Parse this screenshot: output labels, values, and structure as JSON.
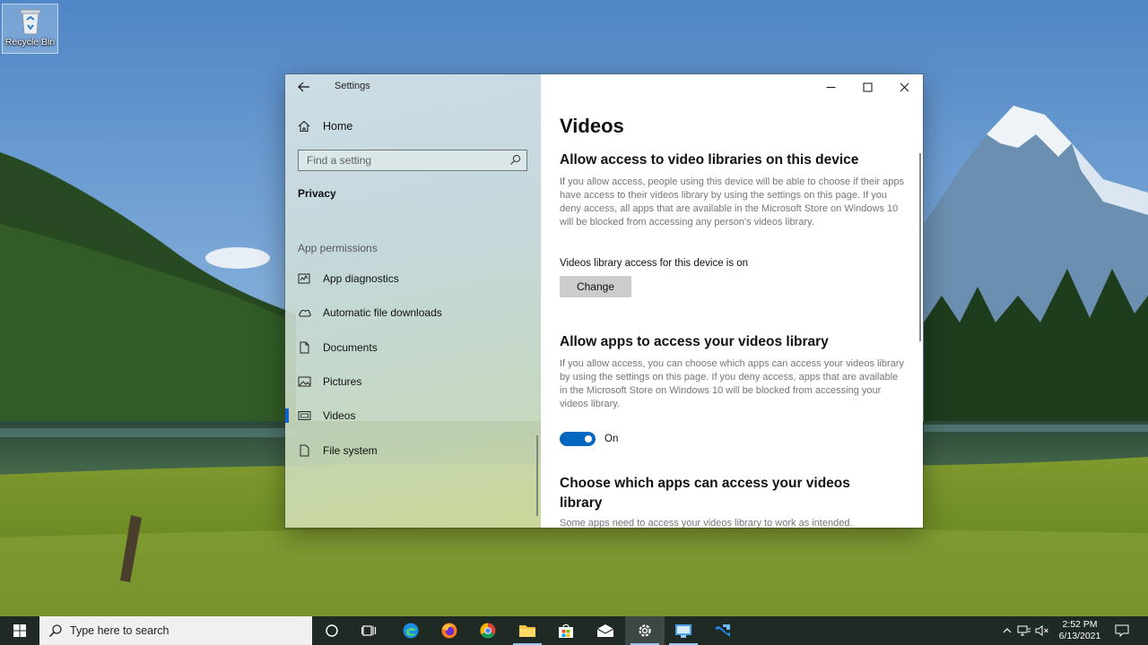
{
  "desktop": {
    "recycle_bin_label": "Recycle Bin"
  },
  "window": {
    "app_title": "Settings",
    "controls": {
      "minimize_icon": "minimize-icon",
      "maximize_icon": "maximize-icon",
      "close_icon": "close-icon"
    }
  },
  "nav": {
    "home_label": "Home",
    "search_placeholder": "Find a setting",
    "section_title": "Privacy",
    "group_title": "App permissions",
    "items": [
      {
        "label": "App diagnostics",
        "icon": "app-diagnostics-icon"
      },
      {
        "label": "Automatic file downloads",
        "icon": "cloud-icon"
      },
      {
        "label": "Documents",
        "icon": "document-icon"
      },
      {
        "label": "Pictures",
        "icon": "picture-icon"
      },
      {
        "label": "Videos",
        "icon": "video-icon",
        "selected": true
      },
      {
        "label": "File system",
        "icon": "file-icon"
      }
    ]
  },
  "content": {
    "page_title": "Videos",
    "section1": {
      "heading": "Allow access to video libraries on this device",
      "description": "If you allow access, people using this device will be able to choose if their apps have access to their videos library by using the settings on this page. If you deny access, all apps that are available in the Microsoft Store on Windows 10 will be blocked from accessing any person's videos library.",
      "status": "Videos library access for this device is on",
      "button_label": "Change"
    },
    "section2": {
      "heading": "Allow apps to access your videos library",
      "description": "If you allow access, you can choose which apps can access your videos library by using the settings on this page. If you deny access, apps that are available in the Microsoft Store on Windows 10 will be blocked from accessing your videos library.",
      "toggle_label": "On",
      "toggle_on": true
    },
    "section3": {
      "heading": "Choose which apps can access your videos library",
      "description": "Some apps need to access your videos library to work as intended."
    }
  },
  "taskbar": {
    "search_placeholder": "Type here to search",
    "apps": [
      "cortana-icon",
      "task-view-icon",
      "edge-icon",
      "firefox-icon",
      "chrome-icon",
      "file-explorer-icon",
      "store-icon",
      "mail-icon",
      "settings-icon",
      "remote-desktop-icon",
      "visual-studio-icon"
    ],
    "clock_time": "2:52 PM",
    "clock_date": "6/13/2021"
  },
  "colors": {
    "accent": "#0067c0",
    "taskbar": "#1f2a24"
  }
}
